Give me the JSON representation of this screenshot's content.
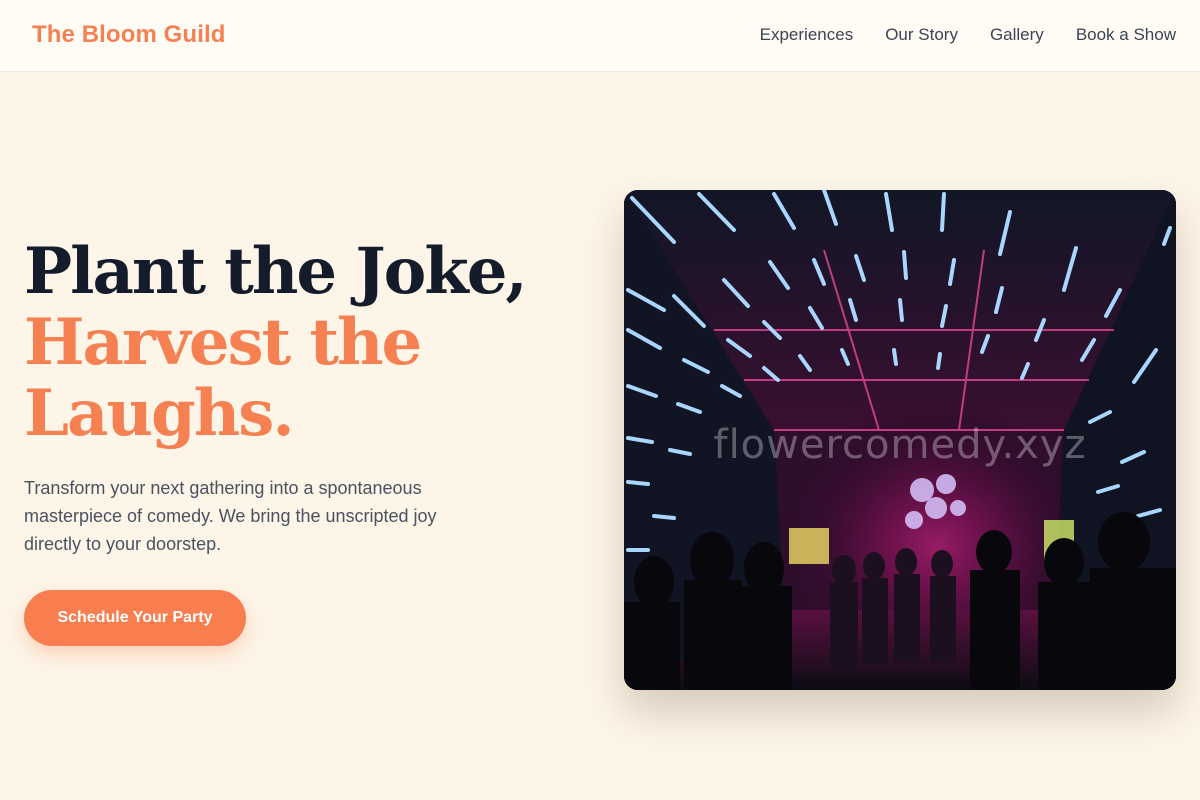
{
  "header": {
    "logo": "The Bloom Guild",
    "nav": [
      "Experiences",
      "Our Story",
      "Gallery",
      "Book a Show"
    ]
  },
  "hero": {
    "headline_line1": "Plant the Joke,",
    "headline_line2": "Harvest the",
    "headline_line3": "Laughs.",
    "lead": "Transform your next gathering into a spontaneous masterpiece of comedy. We bring the unscripted joy directly to your doorstep.",
    "cta_label": "Schedule Your Party"
  },
  "image": {
    "watermark": "flowercomedy.xyz"
  },
  "colors": {
    "accent": "#f58052",
    "background": "#fdf5e8",
    "heading": "#141b2b",
    "body_text": "#4a5261"
  }
}
